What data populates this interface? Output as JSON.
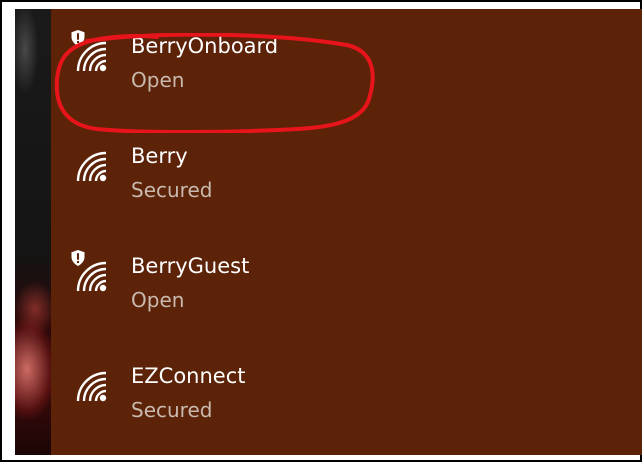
{
  "networks": [
    {
      "ssid": "BerryOnboard",
      "status": "Open",
      "unsecured_shield": true,
      "icon": "wifi-signal-icon",
      "shield_icon": "shield-warning-icon"
    },
    {
      "ssid": "Berry",
      "status": "Secured",
      "unsecured_shield": false,
      "icon": "wifi-signal-icon"
    },
    {
      "ssid": "BerryGuest",
      "status": "Open",
      "unsecured_shield": true,
      "icon": "wifi-signal-icon",
      "shield_icon": "shield-warning-icon"
    },
    {
      "ssid": "EZConnect",
      "status": "Secured",
      "unsecured_shield": false,
      "icon": "wifi-signal-icon"
    }
  ],
  "colors": {
    "flyout_background": "#5c2308",
    "ssid_text": "#ffffff",
    "status_text": "#c9b9ae",
    "highlight_annotation": "#e8141b",
    "frame_border": "#000000"
  },
  "annotation": {
    "type": "hand-drawn-circle",
    "target": "BerryOnboard"
  }
}
